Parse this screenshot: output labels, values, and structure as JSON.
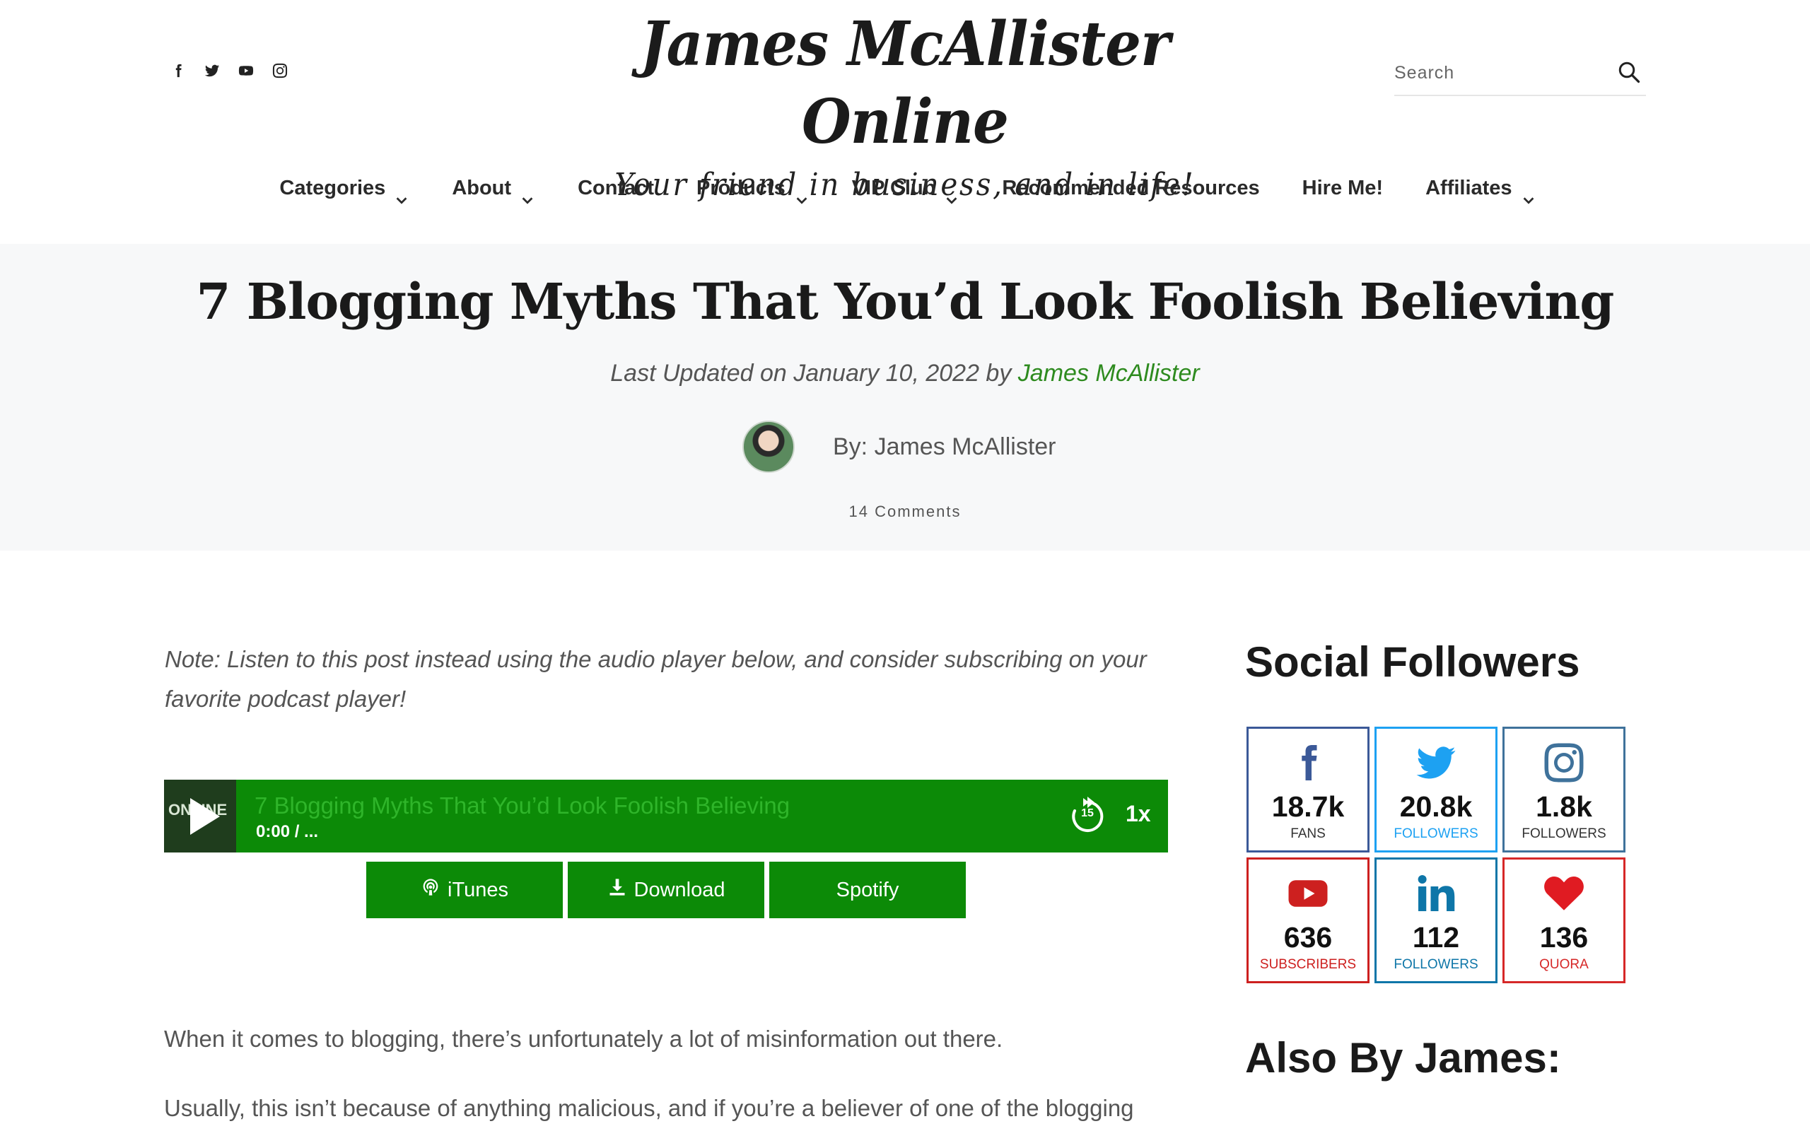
{
  "site": {
    "title": "James McAllister Online",
    "tagline": "Your friend in business, and in life!"
  },
  "social_top": [
    "facebook-icon",
    "twitter-icon",
    "youtube-icon",
    "instagram-icon"
  ],
  "search": {
    "placeholder": "Search"
  },
  "nav": {
    "items": [
      {
        "label": "Categories",
        "dropdown": true
      },
      {
        "label": "About",
        "dropdown": true
      },
      {
        "label": "Contact",
        "dropdown": false
      },
      {
        "label": "Products",
        "dropdown": true
      },
      {
        "label": "VIP Club",
        "dropdown": true
      },
      {
        "label": "Recommended Resources",
        "dropdown": false
      },
      {
        "label": "Hire Me!",
        "dropdown": false
      },
      {
        "label": "Affiliates",
        "dropdown": true
      }
    ]
  },
  "post": {
    "title": "7 Blogging Myths That You’d Look Foolish Believing",
    "updated_prefix": "Last Updated on January 10, 2022 by ",
    "author": "James McAllister",
    "byline": "By: James McAllister",
    "comments": "14 Comments"
  },
  "content": {
    "note": "Note: Listen to this post instead using the audio player below, and consider subscribing on your favorite podcast player!",
    "paragraph1": "When it comes to blogging, there’s unfortunately a lot of misinformation out there.",
    "paragraph2": "Usually, this isn’t because of anything malicious, and if you’re a believer of one of the blogging"
  },
  "player": {
    "thumb_text": "ONLINE",
    "title": "7 Blogging Myths That You’d Look Foolish Believing",
    "time": "0:00 / ...",
    "skip": "15",
    "speed": "1x",
    "buttons": [
      {
        "label": "iTunes",
        "icon": "podcast-icon"
      },
      {
        "label": "Download",
        "icon": "download-icon"
      },
      {
        "label": "Spotify",
        "icon": ""
      }
    ]
  },
  "sidebar": {
    "social_heading": "Social Followers",
    "also_heading": "Also By James:",
    "followers": [
      {
        "network": "facebook",
        "count": "18.7k",
        "label": "FANS",
        "color": "#3b5998",
        "label_color": "#333333"
      },
      {
        "network": "twitter",
        "count": "20.8k",
        "label": "FOLLOWERS",
        "color": "#1da1f2",
        "label_color": "#1da1f2"
      },
      {
        "network": "instagram",
        "count": "1.8k",
        "label": "FOLLOWERS",
        "color": "#3f729b",
        "label_color": "#333333"
      },
      {
        "network": "youtube",
        "count": "636",
        "label": "SUBSCRIBERS",
        "color": "#cd201f",
        "label_color": "#cd201f"
      },
      {
        "network": "linkedin",
        "count": "112",
        "label": "FOLLOWERS",
        "color": "#0e76a8",
        "label_color": "#0e76a8"
      },
      {
        "network": "quora",
        "count": "136",
        "label": "QUORA",
        "color": "#d62828",
        "label_color": "#d62828"
      }
    ]
  },
  "colors": {
    "accent_green": "#0c8a07",
    "author_link": "#2e8b1f",
    "band_bg": "#f7f8f9"
  }
}
